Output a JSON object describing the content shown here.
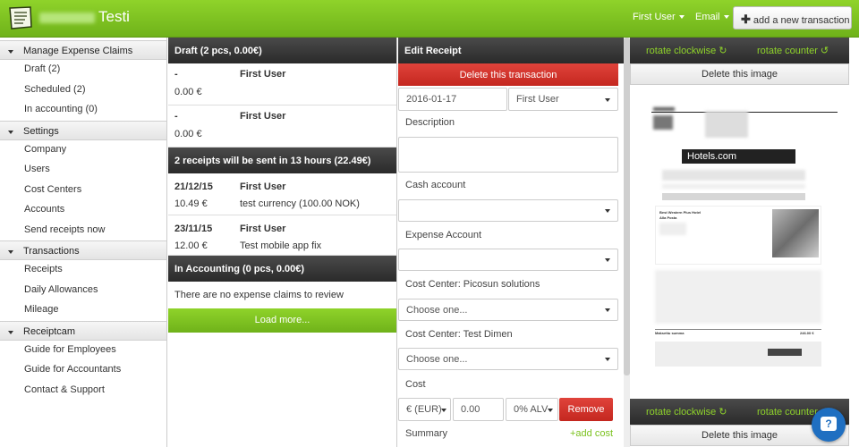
{
  "header": {
    "brand": "Testi",
    "user_menu": "First User",
    "email_menu": "Email",
    "add_button": "add a new transaction"
  },
  "sidebar": {
    "sections": [
      {
        "title": "Manage Expense Claims",
        "items": [
          "Draft (2)",
          "Scheduled (2)",
          "In accounting (0)"
        ]
      },
      {
        "title": "Settings",
        "items": [
          "Company",
          "Users",
          "Cost Centers",
          "Accounts",
          "Send receipts now"
        ]
      },
      {
        "title": "Transactions",
        "items": [
          "Receipts",
          "Daily Allowances",
          "Mileage"
        ]
      },
      {
        "title": "Receiptcam",
        "items": [
          "Guide for Employees",
          "Guide for Accountants",
          "Contact & Support"
        ]
      }
    ]
  },
  "list": {
    "draft_header": "Draft (2 pcs, 0.00€)",
    "drafts": [
      {
        "date": "-",
        "user": "First User",
        "amount": "0.00 €",
        "desc": ""
      },
      {
        "date": "-",
        "user": "First User",
        "amount": "0.00 €",
        "desc": ""
      }
    ],
    "scheduled_header": "2 receipts will be sent in 13 hours (22.49€)",
    "scheduled": [
      {
        "date": "21/12/15",
        "user": "First User",
        "amount": "10.49 €",
        "desc": "test currency (100.00 NOK)"
      },
      {
        "date": "23/11/15",
        "user": "First User",
        "amount": "12.00 €",
        "desc": "Test mobile app fix"
      }
    ],
    "accounting_header": "In Accounting (0 pcs, 0.00€)",
    "accounting_empty": "There are no expense claims to review",
    "load_more": "Load more..."
  },
  "edit": {
    "title": "Edit Receipt",
    "delete_button": "Delete this transaction",
    "date": "2016-01-17",
    "user": "First User",
    "description_label": "Description",
    "cash_account_label": "Cash account",
    "expense_account_label": "Expense Account",
    "cost_center_1_label": "Cost Center: Picosun solutions",
    "cost_center_1_value": "Choose one...",
    "cost_center_2_label": "Cost Center: Test Dimen",
    "cost_center_2_value": "Choose one...",
    "cost_label": "Cost",
    "currency": "€ (EUR)",
    "amount_placeholder": "0.00",
    "vat": "0% ALV",
    "remove_button": "Remove",
    "summary_label": "Summary",
    "add_cost": "+add cost"
  },
  "image_panel": {
    "rotate_cw": "rotate clockwise ↻",
    "rotate_ccw": "rotate counter ↺",
    "delete_image": "Delete this image",
    "receipt_brand": "Hotels.com",
    "hotel_name": "Best Western Plus Hotel",
    "hotel_sub": "Alla Posta",
    "total_label": "Maksettu summa",
    "total_value": "246.00 €"
  },
  "help_icon": "?"
}
